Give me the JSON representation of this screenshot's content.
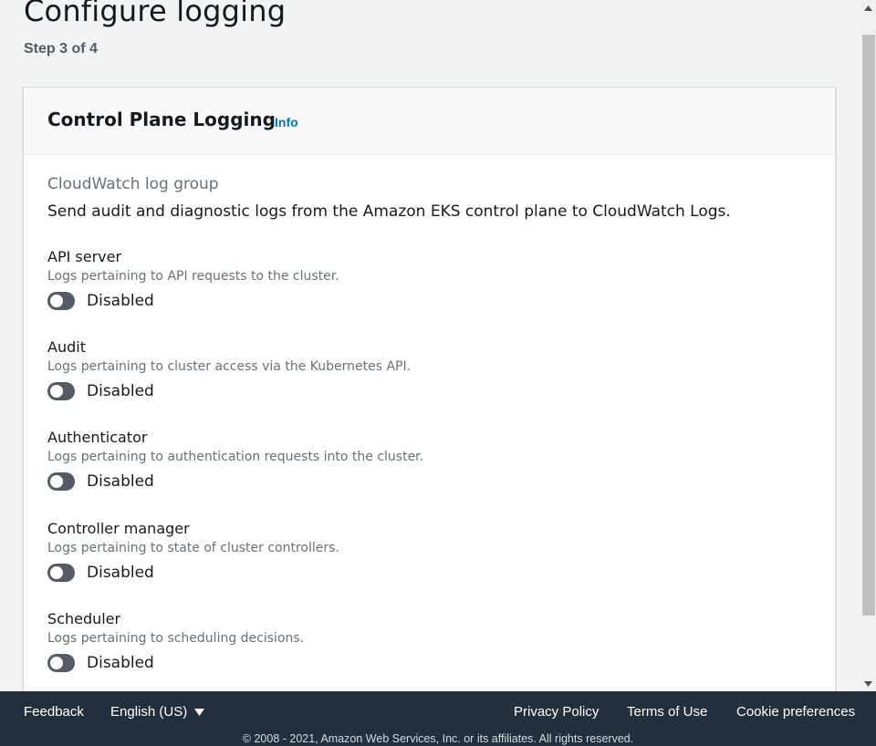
{
  "page": {
    "title": "Configure logging",
    "step": "Step 3 of 4"
  },
  "panel": {
    "title": "Control Plane Logging",
    "info_label": "Info",
    "group_label": "CloudWatch log group",
    "group_description": "Send audit and diagnostic logs from the Amazon EKS control plane to CloudWatch Logs.",
    "items": [
      {
        "title": "API server",
        "description": "Logs pertaining to API requests to the cluster.",
        "state": "Disabled",
        "enabled": false
      },
      {
        "title": "Audit",
        "description": "Logs pertaining to cluster access via the Kubernetes API.",
        "state": "Disabled",
        "enabled": false
      },
      {
        "title": "Authenticator",
        "description": "Logs pertaining to authentication requests into the cluster.",
        "state": "Disabled",
        "enabled": false
      },
      {
        "title": "Controller manager",
        "description": "Logs pertaining to state of cluster controllers.",
        "state": "Disabled",
        "enabled": false
      },
      {
        "title": "Scheduler",
        "description": "Logs pertaining to scheduling decisions.",
        "state": "Disabled",
        "enabled": false
      }
    ]
  },
  "footer": {
    "feedback": "Feedback",
    "language": "English (US)",
    "language_caret_icon": "caret-down-icon",
    "privacy": "Privacy Policy",
    "terms": "Terms of Use",
    "cookies": "Cookie preferences",
    "copyright": "© 2008 - 2021, Amazon Web Services, Inc. or its affiliates. All rights reserved."
  },
  "colors": {
    "footer_bg": "#232f3e",
    "link": "#0073bb",
    "toggle_off": "#545b64"
  }
}
